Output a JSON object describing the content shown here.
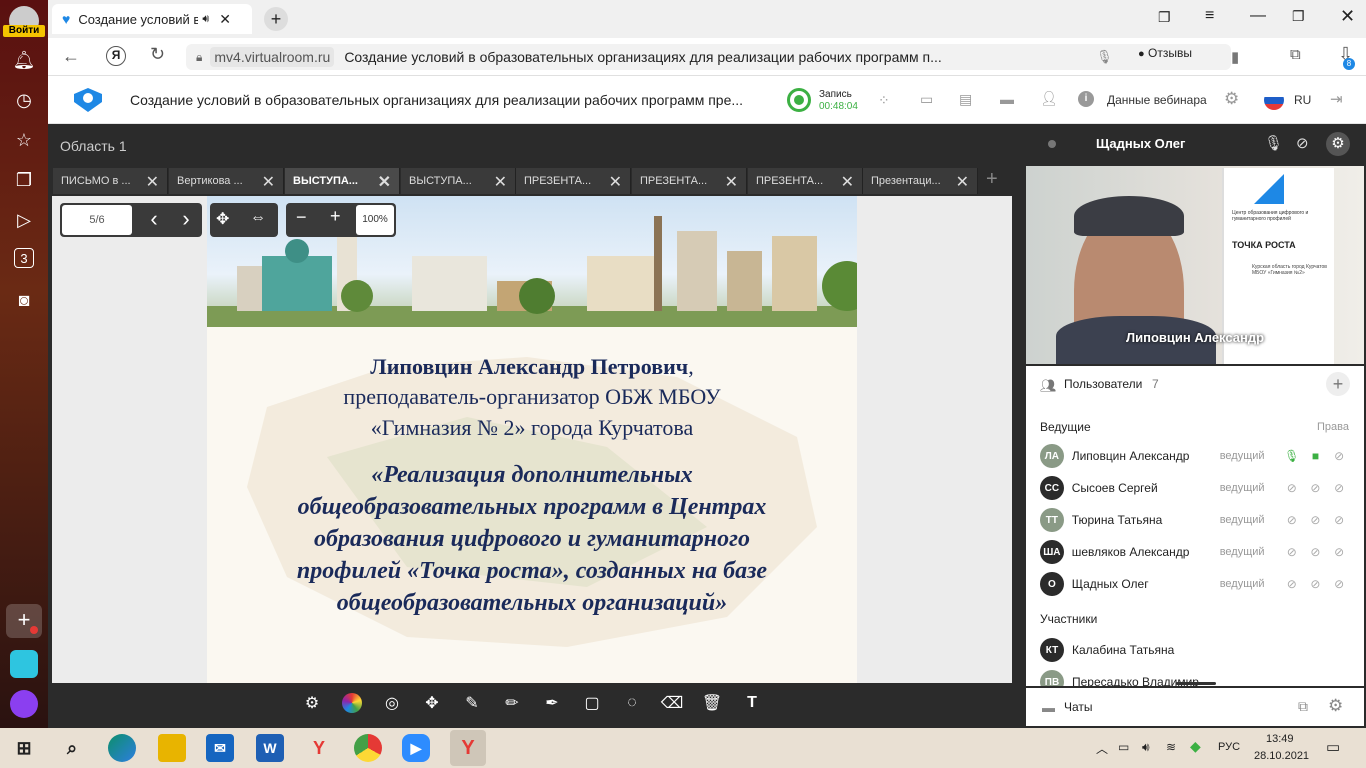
{
  "browser": {
    "login_label": "Войти",
    "tab_title": "Создание условий в",
    "url_domain": "mv4.virtualroom.ru",
    "url_title": "Создание условий в образовательных организациях для реализации рабочих программ п...",
    "reviews_label": "Отзывы",
    "download_badge": "8"
  },
  "header": {
    "title": "Создание условий в образовательных организациях для реализации рабочих программ пре...",
    "record_label": "Запись",
    "record_time": "00:48:04",
    "webinar_data_label": "Данные вебинара",
    "lang": "RU"
  },
  "workspace": {
    "area_title": "Область 1",
    "tabs": [
      {
        "label": "ПИСЬМО в ..."
      },
      {
        "label": "Вертикова ..."
      },
      {
        "label": "ВЫСТУПА..."
      },
      {
        "label": "ВЫСТУПА..."
      },
      {
        "label": "ПРЕЗЕНТА..."
      },
      {
        "label": "ПРЕЗЕНТА..."
      },
      {
        "label": "ПРЕЗЕНТА..."
      },
      {
        "label": "Презентаци..."
      }
    ],
    "page_indicator": "5/6",
    "zoom": "100%"
  },
  "slide": {
    "author_name": "Липовцин Александр Петрович",
    "author_role_1": "преподаватель-организатор ОБЖ МБОУ",
    "author_role_2": "«Гимназия № 2» города Курчатова",
    "topic_1": "«Реализация дополнительных",
    "topic_2": "общеобразовательных программ в Центрах",
    "topic_3": "образования цифрового и гуманитарного",
    "topic_4": "профилей «Точка роста», созданных на базе",
    "topic_5": "общеобразовательных организаций»"
  },
  "video": {
    "panel_name": "Щадных Олег",
    "speaker_name": "Липовцин Александр",
    "banner_text_1": "Центр образования цифрового и гуманитарного профилей",
    "banner_brand": "ТОЧКА РОСТА",
    "banner_text_2": "Курская область город Курчатов МБОУ «Гимназия №2»"
  },
  "users": {
    "title": "Пользователи",
    "count": "7",
    "hosts_label": "Ведущие",
    "rights_label": "Права",
    "hosts": [
      {
        "initials": "ЛА",
        "name": "Липовцин Александр",
        "role": "ведущий",
        "color": "#8a9a86"
      },
      {
        "initials": "СС",
        "name": "Сысоев Сергей",
        "role": "ведущий",
        "color": "#2b2b2b"
      },
      {
        "initials": "ТТ",
        "name": "Тюрина Татьяна",
        "role": "ведущий",
        "color": "#8a9a86"
      },
      {
        "initials": "ША",
        "name": "шевляков Александр",
        "role": "ведущий",
        "color": "#2b2b2b"
      },
      {
        "initials": "О",
        "name": "Щадных Олег",
        "role": "ведущий",
        "color": "#2b2b2b"
      }
    ],
    "participants_label": "Участники",
    "participants": [
      {
        "initials": "КТ",
        "name": "Калабина Татьяна",
        "color": "#2b2b2b"
      },
      {
        "initials": "ПВ",
        "name": "Пересадько Владимир",
        "color": "#8a9a86"
      }
    ],
    "chats_label": "Чаты"
  },
  "taskbar": {
    "lang": "РУС",
    "time": "13:49",
    "date": "28.10.2021"
  },
  "colors": {
    "accent_green": "#3cb043",
    "brand_blue": "#1e88e5",
    "slide_navy": "#1a2a5a"
  }
}
